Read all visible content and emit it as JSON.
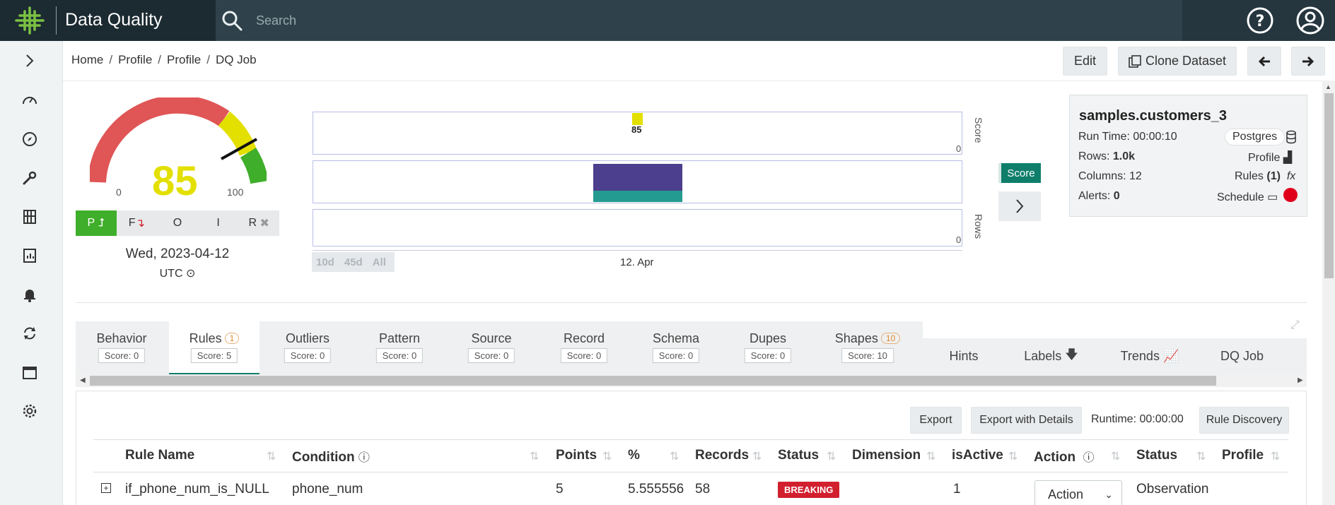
{
  "app": {
    "title": "Data Quality"
  },
  "search": {
    "placeholder": "Search"
  },
  "breadcrumb": [
    "Home",
    "Profile",
    "Profile",
    "DQ Job"
  ],
  "toolbar": {
    "edit_label": "Edit",
    "clone_label": "Clone Dataset"
  },
  "gauge": {
    "score": "85",
    "min": "0",
    "max": "100",
    "value": 85
  },
  "status_buttons": [
    "P",
    "F",
    "O",
    "I",
    "R"
  ],
  "run_date": "Wed, 2023-04-12",
  "timezone": "UTC",
  "charts": {
    "score_value": "85",
    "zero": "0",
    "score_label": "Score",
    "rows_label": "Rows",
    "date_tick": "12. Apr",
    "ranges": [
      "10d",
      "45d",
      "All"
    ],
    "toggle_label": "Score"
  },
  "dataset": {
    "name": "samples.customers_3",
    "run_time_label": "Run Time:",
    "run_time": "00:00:10",
    "source": "Postgres",
    "rows_label": "Rows:",
    "rows": "1.0k",
    "profile_label": "Profile",
    "columns_label": "Columns:",
    "columns": "12",
    "rules_label": "Rules",
    "rules_count": "(1)",
    "fx": "fx",
    "alerts_label": "Alerts:",
    "alerts": "0",
    "schedule_label": "Schedule"
  },
  "tabs": [
    {
      "label": "Behavior",
      "score": "Score: 0"
    },
    {
      "label": "Rules",
      "badge": "1",
      "score": "Score: 5"
    },
    {
      "label": "Outliers",
      "score": "Score: 0"
    },
    {
      "label": "Pattern",
      "score": "Score: 0"
    },
    {
      "label": "Source",
      "score": "Score: 0"
    },
    {
      "label": "Record",
      "score": "Score: 0"
    },
    {
      "label": "Schema",
      "score": "Score: 0"
    },
    {
      "label": "Dupes",
      "score": "Score: 0"
    },
    {
      "label": "Shapes",
      "badge": "10",
      "score": "Score: 10"
    }
  ],
  "tabs_right": [
    "Hints",
    "Labels",
    "Trends",
    "DQ Job"
  ],
  "panel_buttons": {
    "export": "Export",
    "export_details": "Export with Details",
    "runtime": "Runtime: 00:00:00",
    "rule_discovery": "Rule Discovery"
  },
  "table": {
    "headers": [
      "Rule Name",
      "Condition",
      "Points",
      "%",
      "Records",
      "Status",
      "Dimension",
      "isActive",
      "Action",
      "Status",
      "Profile"
    ],
    "rows": [
      {
        "rule_name": "if_phone_num_is_NULL",
        "condition": "phone_num",
        "points": "5",
        "percent": "5.555556",
        "records": "58",
        "status": "BREAKING",
        "is_active": "1",
        "action": "Action",
        "status2": "Observation"
      }
    ]
  },
  "colors": {
    "topbar": "#25363f",
    "accent": "#0e7e6b",
    "gauge_red": "#e05555",
    "gauge_yellow": "#e3e000",
    "gauge_green": "#3fae2a",
    "breaking": "#d21f2e"
  }
}
